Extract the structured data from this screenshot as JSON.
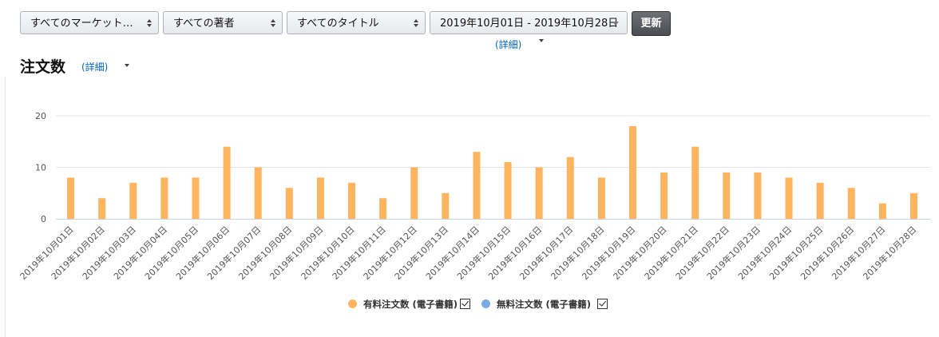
{
  "filters": {
    "marketplace": "すべてのマーケット…",
    "author": "すべての著者",
    "title": "すべてのタイトル",
    "date_range": "2019年10月01日 - 2019年10月28日",
    "update_label": "更新",
    "date_details_label": "(詳細)"
  },
  "heading": {
    "title": "注文数",
    "details_label": "(詳細)"
  },
  "colors": {
    "paid": "#ffb45f",
    "free": "#7aabe0",
    "grid": "#e6e6e6",
    "axis": "#c8d3e6"
  },
  "chart_data": {
    "type": "bar",
    "title": "注文数",
    "xlabel": "",
    "ylabel": "",
    "ylim": [
      0,
      20
    ],
    "yticks": [
      0,
      10,
      20
    ],
    "grid": true,
    "legend_position": "bottom",
    "categories": [
      "2019年10月01日",
      "2019年10月02日",
      "2019年10月03日",
      "2019年10月04日",
      "2019年10月05日",
      "2019年10月06日",
      "2019年10月07日",
      "2019年10月08日",
      "2019年10月09日",
      "2019年10月10日",
      "2019年10月11日",
      "2019年10月12日",
      "2019年10月13日",
      "2019年10月14日",
      "2019年10月15日",
      "2019年10月16日",
      "2019年10月17日",
      "2019年10月18日",
      "2019年10月19日",
      "2019年10月20日",
      "2019年10月21日",
      "2019年10月22日",
      "2019年10月23日",
      "2019年10月24日",
      "2019年10月25日",
      "2019年10月26日",
      "2019年10月27日",
      "2019年10月28日"
    ],
    "series": [
      {
        "name": "有料注文数 (電子書籍)",
        "color": "#ffb45f",
        "values": [
          8,
          4,
          7,
          8,
          8,
          14,
          10,
          6,
          8,
          7,
          4,
          10,
          5,
          13,
          11,
          10,
          12,
          8,
          18,
          9,
          14,
          9,
          9,
          8,
          7,
          6,
          3,
          5
        ]
      },
      {
        "name": "無料注文数 (電子書籍)",
        "color": "#7aabe0",
        "values": [
          0,
          0,
          0,
          0,
          0,
          0,
          0,
          0,
          0,
          0,
          0,
          0,
          0,
          0,
          0,
          0,
          0,
          0,
          0,
          0,
          0,
          0,
          0,
          0,
          0,
          0,
          0,
          0
        ]
      }
    ]
  },
  "legend": {
    "paid_label": "有料注文数 (電子書籍)",
    "free_label": "無料注文数 (電子書籍)"
  }
}
